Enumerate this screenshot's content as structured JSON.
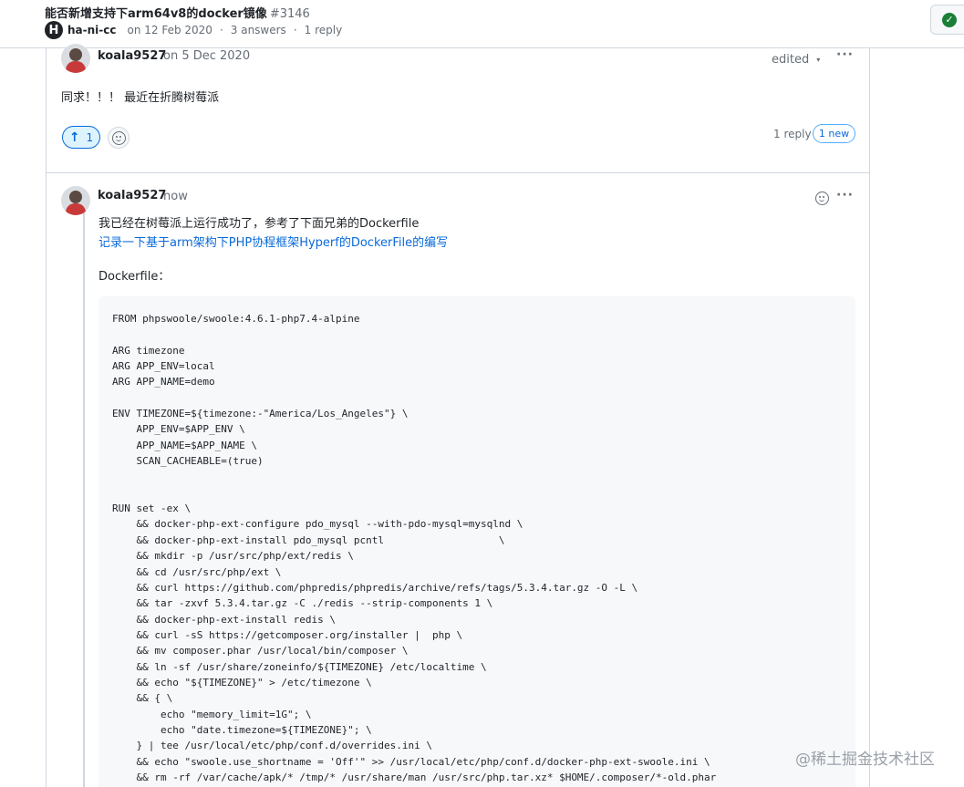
{
  "header": {
    "title": "能否新增支持下arm64v8的docker镜像",
    "number": "#3146",
    "repo_logo": "H",
    "author": "ha-ni-cc",
    "date": "on 12 Feb 2020",
    "answers": "3 answers",
    "replies": "1 reply",
    "sep": "·"
  },
  "top_comment": {
    "author": "koala9527",
    "date": "on 5 Dec 2020",
    "edited": "edited",
    "caret": "▾",
    "more": "···",
    "body": "同求！！！ 最近在折腾树莓派",
    "upvote_arrow": "↑",
    "upvote_count": "1",
    "reply_count": "1 reply",
    "new_badge": "1 new"
  },
  "reply": {
    "author": "koala9527",
    "time": "now",
    "more": "···",
    "line1": "我已经在树莓派上运行成功了，参考了下面兄弟的Dockerfile",
    "link": "记录一下基于arm架构下PHP协程框架Hyperf的DockerFile的编写",
    "label": "Dockerfile：",
    "code": "FROM phpswoole/swoole:4.6.1-php7.4-alpine\n\nARG timezone\nARG APP_ENV=local\nARG APP_NAME=demo\n\nENV TIMEZONE=${timezone:-\"America/Los_Angeles\"} \\\n    APP_ENV=$APP_ENV \\\n    APP_NAME=$APP_NAME \\\n    SCAN_CACHEABLE=(true)\n\n\nRUN set -ex \\\n    && docker-php-ext-configure pdo_mysql --with-pdo-mysql=mysqlnd \\\n    && docker-php-ext-install pdo_mysql pcntl                   \\\n    && mkdir -p /usr/src/php/ext/redis \\\n    && cd /usr/src/php/ext \\\n    && curl https://github.com/phpredis/phpredis/archive/refs/tags/5.3.4.tar.gz -O -L \\\n    && tar -zxvf 5.3.4.tar.gz -C ./redis --strip-components 1 \\\n    && docker-php-ext-install redis \\\n    && curl -sS https://getcomposer.org/installer |  php \\\n    && mv composer.phar /usr/local/bin/composer \\\n    && ln -sf /usr/share/zoneinfo/${TIMEZONE} /etc/localtime \\\n    && echo \"${TIMEZONE}\" > /etc/timezone \\\n    && { \\\n        echo \"memory_limit=1G\"; \\\n        echo \"date.timezone=${TIMEZONE}\"; \\\n    } | tee /usr/local/etc/php/conf.d/overrides.ini \\\n    && echo \"swoole.use_shortname = 'Off'\" >> /usr/local/etc/php/conf.d/docker-php-ext-swoole.ini \\\n    && rm -rf /var/cache/apk/* /tmp/* /usr/share/man /usr/src/php.tar.xz* $HOME/.composer/*-old.phar"
  },
  "watermark": "@稀土掘金技术社区",
  "colors": {
    "accent": "#0969da",
    "success": "#1a7f37",
    "border": "#d0d7de",
    "muted": "#656d76",
    "code_bg": "#f6f8fa"
  },
  "icons": {
    "answered": "check-circle-icon",
    "logo": "hyperf-logo-icon",
    "upvote": "arrow-up-icon",
    "emoji": "smiley-icon",
    "more": "kebab-horizontal-icon",
    "caret": "triangle-down-icon"
  }
}
